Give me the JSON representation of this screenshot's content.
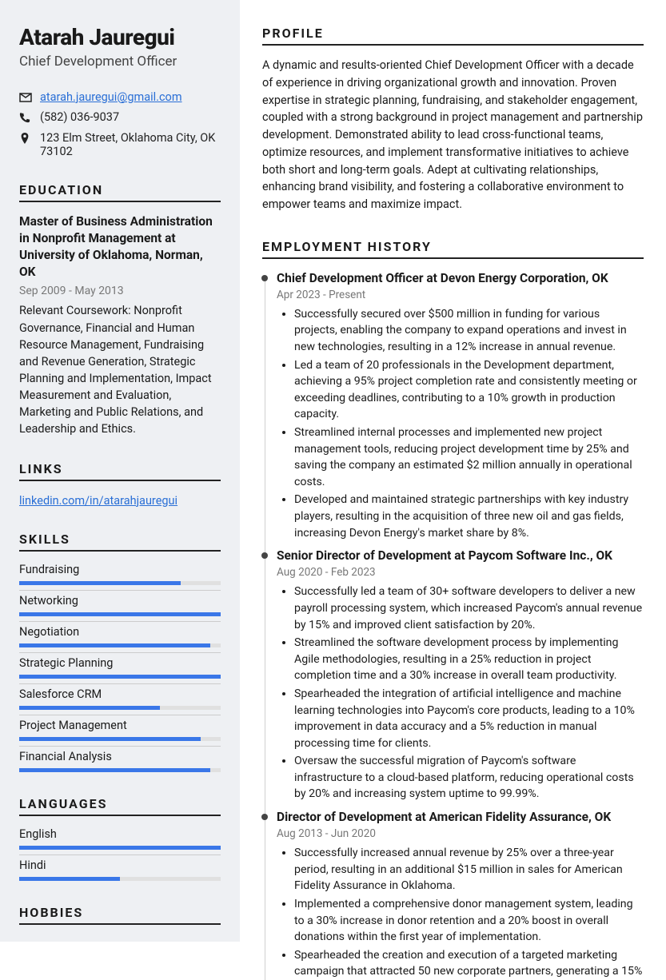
{
  "name": "Atarah Jauregui",
  "title": "Chief Development Officer",
  "contact": {
    "email": "atarah.jauregui@gmail.com",
    "phone": "(582) 036-9037",
    "address": "123 Elm Street, Oklahoma City, OK 73102"
  },
  "headings": {
    "education": "Education",
    "links": "Links",
    "skills": "Skills",
    "languages": "Languages",
    "hobbies": "Hobbies",
    "profile": "Profile",
    "employment": "Employment History"
  },
  "education": {
    "degree": "Master of Business Administration in Nonprofit Management at University of Oklahoma, Norman, OK",
    "dates": "Sep 2009 - May 2013",
    "coursework": "Relevant Coursework: Nonprofit Governance, Financial and Human Resource Management, Fundraising and Revenue Generation, Strategic Planning and Implementation, Impact Measurement and Evaluation, Marketing and Public Relations, and Leadership and Ethics."
  },
  "links": {
    "linkedin": "linkedin.com/in/atarahjauregui"
  },
  "skills": [
    {
      "label": "Fundraising",
      "level": 80
    },
    {
      "label": "Networking",
      "level": 100
    },
    {
      "label": "Negotiation",
      "level": 95
    },
    {
      "label": "Strategic Planning",
      "level": 100
    },
    {
      "label": "Salesforce CRM",
      "level": 70
    },
    {
      "label": "Project Management",
      "level": 90
    },
    {
      "label": "Financial Analysis",
      "level": 95
    }
  ],
  "languages": [
    {
      "label": "English",
      "level": 100
    },
    {
      "label": "Hindi",
      "level": 50
    }
  ],
  "profile": "A dynamic and results-oriented Chief Development Officer with a decade of experience in driving organizational growth and innovation. Proven expertise in strategic planning, fundraising, and stakeholder engagement, coupled with a strong background in project management and partnership development. Demonstrated ability to lead cross-functional teams, optimize resources, and implement transformative initiatives to achieve both short and long-term goals. Adept at cultivating relationships, enhancing brand visibility, and fostering a collaborative environment to empower teams and maximize impact.",
  "jobs": [
    {
      "title": "Chief Development Officer at Devon Energy Corporation, OK",
      "dates": "Apr 2023 - Present",
      "bullets": [
        "Successfully secured over $500 million in funding for various projects, enabling the company to expand operations and invest in new technologies, resulting in a 12% increase in annual revenue.",
        "Led a team of 20 professionals in the Development department, achieving a 95% project completion rate and consistently meeting or exceeding deadlines, contributing to a 10% growth in production capacity.",
        "Streamlined internal processes and implemented new project management tools, reducing project development time by 25% and saving the company an estimated $2 million annually in operational costs.",
        "Developed and maintained strategic partnerships with key industry players, resulting in the acquisition of three new oil and gas fields, increasing Devon Energy's market share by 8%."
      ]
    },
    {
      "title": "Senior Director of Development at Paycom Software Inc., OK",
      "dates": "Aug 2020 - Feb 2023",
      "bullets": [
        "Successfully led a team of 30+ software developers to deliver a new payroll processing system, which increased Paycom's annual revenue by 15% and improved client satisfaction by 20%.",
        "Streamlined the software development process by implementing Agile methodologies, resulting in a 25% reduction in project completion time and a 30% increase in overall team productivity.",
        "Spearheaded the integration of artificial intelligence and machine learning technologies into Paycom's core products, leading to a 10% improvement in data accuracy and a 5% reduction in manual processing time for clients.",
        "Oversaw the successful migration of Paycom's software infrastructure to a cloud-based platform, reducing operational costs by 20% and increasing system uptime to 99.99%."
      ]
    },
    {
      "title": "Director of Development at American Fidelity Assurance, OK",
      "dates": "Aug 2013 - Jun 2020",
      "bullets": [
        "Successfully increased annual revenue by 25% over a three-year period, resulting in an additional $15 million in sales for American Fidelity Assurance in Oklahoma.",
        "Implemented a comprehensive donor management system, leading to a 30% increase in donor retention and a 20% boost in overall donations within the first year of implementation.",
        "Spearheaded the creation and execution of a targeted marketing campaign that attracted 50 new corporate partners, generating a 15%"
      ]
    }
  ]
}
